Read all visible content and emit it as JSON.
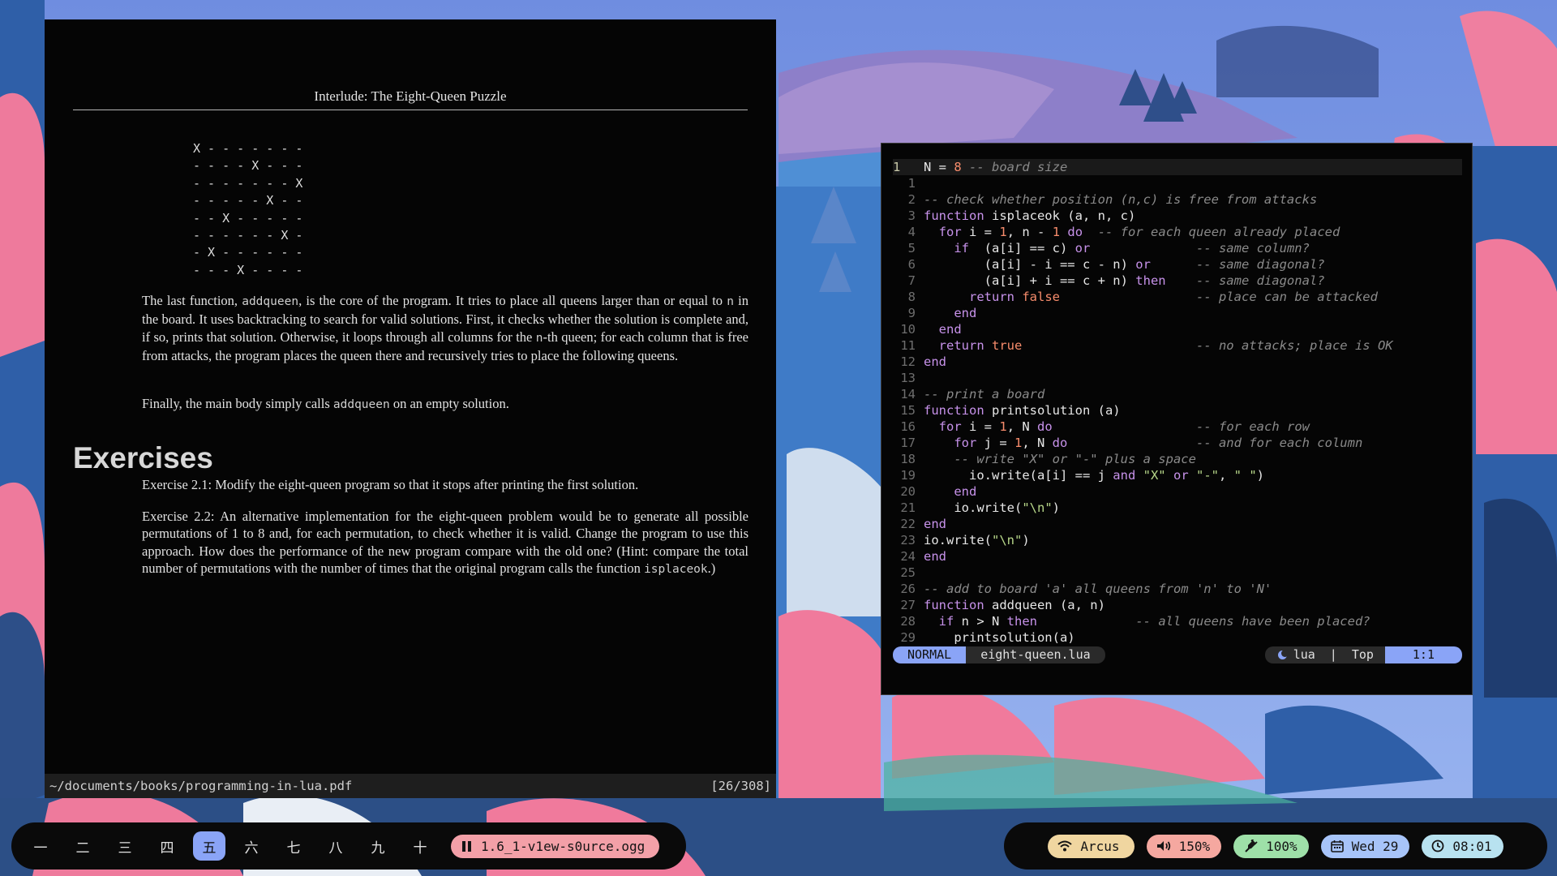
{
  "pdf": {
    "header": "Interlude: The Eight-Queen Puzzle",
    "board": [
      "X - - - - - - -",
      "- - - - X - - -",
      "- - - - - - - X",
      "- - - - - X - -",
      "- - X - - - - -",
      "- - - - - - X -",
      "- X - - - - - -",
      "- - - X - - - -"
    ],
    "para1": {
      "a": "The last function, ",
      "code1": "addqueen",
      "b": ", is the core of the program. It tries to place all queens larger than or equal to ",
      "code2": "n",
      "c": " in the board. It uses backtracking to search for valid solutions. First, it checks whether the solution is complete and, if so, prints that solution. Otherwise, it loops through all columns for the ",
      "code3": "n",
      "d": "-th queen; for each column that is free from attacks, the program places the queen there and recursively tries to place the following queens."
    },
    "para2": {
      "a": "Finally, the main body simply calls ",
      "code": "addqueen",
      "b": " on an empty solution."
    },
    "section_title": "Exercises",
    "exercise1": "Exercise 2.1: Modify the eight-queen program so that it stops after printing the first solution.",
    "exercise2": {
      "a": "Exercise 2.2: An alternative implementation for the eight-queen problem would be to generate all possible permutations of 1 to 8 and, for each permutation, to check whether it is valid. Change the program to use this approach. How does the performance of the new program compare with the old one? (Hint: compare the total number of permutations with the number of times that the original program calls the function ",
      "code": "isplaceok",
      "b": ".)"
    },
    "status_path": "~/documents/books/programming-in-lua.pdf",
    "status_page": "[26/308]"
  },
  "editor": {
    "lines": [
      {
        "n": "1",
        "text": "N = 8 -- board size"
      },
      {
        "n": "1",
        "text": ""
      },
      {
        "n": "2",
        "text": "-- check whether position (n,c) is free from attacks"
      },
      {
        "n": "3",
        "text": "function isplaceok (a, n, c)"
      },
      {
        "n": "4",
        "text": "  for i = 1, n - 1 do  -- for each queen already placed"
      },
      {
        "n": "5",
        "text": "    if  (a[i] == c) or              -- same column?"
      },
      {
        "n": "6",
        "text": "        (a[i] - i == c - n) or      -- same diagonal?"
      },
      {
        "n": "7",
        "text": "        (a[i] + i == c + n) then    -- same diagonal?"
      },
      {
        "n": "8",
        "text": "      return false                  -- place can be attacked"
      },
      {
        "n": "9",
        "text": "    end"
      },
      {
        "n": "10",
        "text": "  end"
      },
      {
        "n": "11",
        "text": "  return true                       -- no attacks; place is OK"
      },
      {
        "n": "12",
        "text": "end"
      },
      {
        "n": "13",
        "text": ""
      },
      {
        "n": "14",
        "text": "-- print a board"
      },
      {
        "n": "15",
        "text": "function printsolution (a)"
      },
      {
        "n": "16",
        "text": "  for i = 1, N do                   -- for each row"
      },
      {
        "n": "17",
        "text": "    for j = 1, N do                 -- and for each column"
      },
      {
        "n": "18",
        "text": "    -- write \"X\" or \"-\" plus a space"
      },
      {
        "n": "19",
        "text": "      io.write(a[i] == j and \"X\" or \"-\", \" \")"
      },
      {
        "n": "20",
        "text": "    end"
      },
      {
        "n": "21",
        "text": "    io.write(\"\\n\")"
      },
      {
        "n": "22",
        "text": "end"
      },
      {
        "n": "23",
        "text": "io.write(\"\\n\")"
      },
      {
        "n": "24",
        "text": "end"
      },
      {
        "n": "25",
        "text": ""
      },
      {
        "n": "26",
        "text": "-- add to board 'a' all queens from 'n' to 'N'"
      },
      {
        "n": "27",
        "text": "function addqueen (a, n)"
      },
      {
        "n": "28",
        "text": "  if n > N then             -- all queens have been placed?"
      },
      {
        "n": "29",
        "text": "    printsolution(a)"
      }
    ],
    "mode": "NORMAL",
    "filename": "eight-queen.lua",
    "filetype": "lua",
    "separator": "|",
    "scroll": "Top",
    "cursor": "1:1"
  },
  "workspaces": [
    "一",
    "二",
    "三",
    "四",
    "五",
    "六",
    "七",
    "八",
    "九",
    "十"
  ],
  "active_workspace": 4,
  "media": {
    "title": "1.6_1-v1ew-s0urce.ogg",
    "icon": "pause-icon"
  },
  "status": {
    "wifi": "Arcus",
    "volume": "150%",
    "battery": "100%",
    "date": "Wed 29",
    "time": "08:01"
  },
  "colors": {
    "accent": "#8aa4f7",
    "media_pill": "#f3a0a8",
    "wifi_pill": "#f0d6a0",
    "volume_pill": "#f5a8a0",
    "battery_pill": "#9ee0a8",
    "date_pill": "#a7c4f9",
    "time_pill": "#b8e2f0"
  }
}
